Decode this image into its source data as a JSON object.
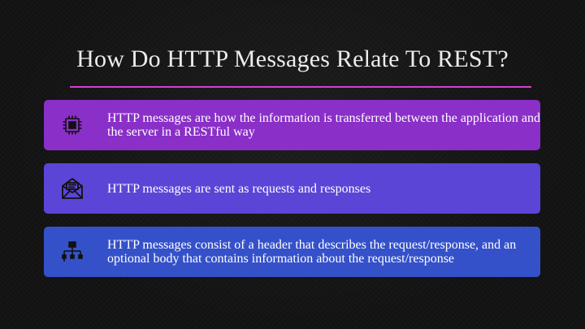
{
  "slide": {
    "title": "How Do HTTP Messages Relate To REST?",
    "accent_color": "#d63ed0",
    "cards": [
      {
        "icon": "processor-chip-icon",
        "color": "#8a2fc8",
        "text": "HTTP messages are how the information is transferred between the application and the server in a RESTful way"
      },
      {
        "icon": "open-envelope-icon",
        "color": "#5b45d6",
        "text": "HTTP messages are sent as requests and responses"
      },
      {
        "icon": "hierarchy-icon",
        "color": "#3551c9",
        "text": "HTTP messages consist of a header that describes the request/response, and an optional body that contains information about the request/response"
      }
    ]
  }
}
